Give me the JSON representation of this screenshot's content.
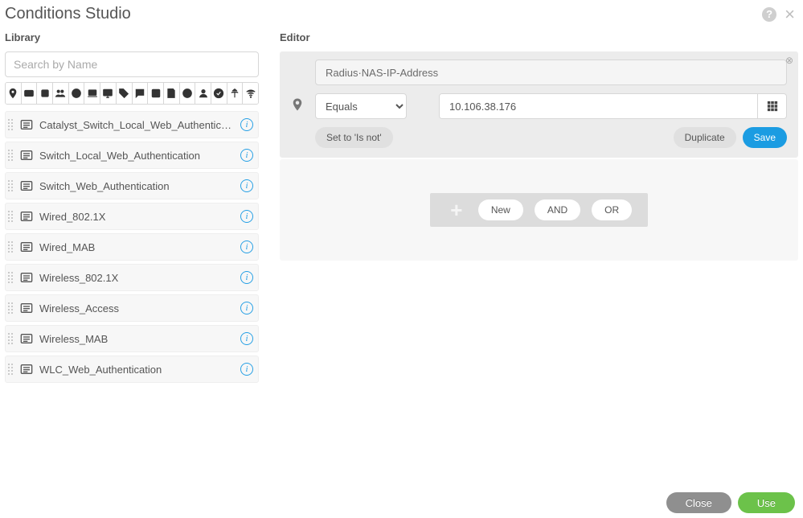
{
  "header": {
    "title": "Conditions Studio"
  },
  "library": {
    "label": "Library",
    "search_placeholder": "Search by Name",
    "items": [
      {
        "label": "Catalyst_Switch_Local_Web_Authentication"
      },
      {
        "label": "Switch_Local_Web_Authentication"
      },
      {
        "label": "Switch_Web_Authentication"
      },
      {
        "label": "Wired_802.1X"
      },
      {
        "label": "Wired_MAB"
      },
      {
        "label": "Wireless_802.1X"
      },
      {
        "label": "Wireless_Access"
      },
      {
        "label": "Wireless_MAB"
      },
      {
        "label": "WLC_Web_Authentication"
      }
    ]
  },
  "editor": {
    "label": "Editor",
    "attribute": "Radius·NAS-IP-Address",
    "operator": "Equals",
    "value": "10.106.38.176",
    "set_isnot": "Set to 'Is not'",
    "duplicate": "Duplicate",
    "save": "Save",
    "combo": {
      "new": "New",
      "and": "AND",
      "or": "OR"
    }
  },
  "footer": {
    "close": "Close",
    "use": "Use"
  }
}
